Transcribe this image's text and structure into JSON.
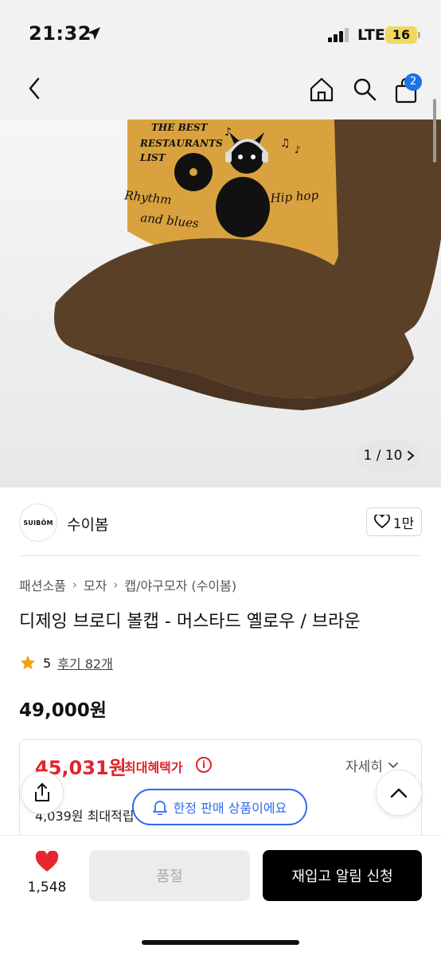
{
  "status_bar": {
    "time": "21:32",
    "network": "LTE",
    "battery": "16"
  },
  "nav": {
    "cart_count": "2"
  },
  "gallery": {
    "counter": "1 / 10",
    "cap_text": {
      "line1": "THE BEST",
      "line2": "RESTAURANTS",
      "line3": "LIST",
      "rhythm": "Rhythm",
      "blues": "and blues",
      "hiphop": "Hip hop"
    }
  },
  "brand": {
    "logo_text": "SUIBŌM",
    "name": "수이봄",
    "likes": "1만"
  },
  "breadcrumb": [
    "패션소품",
    "모자",
    "캡/야구모자 (수이봄)"
  ],
  "product": {
    "title": "디제잉 브로디 볼캡 - 머스타드 옐로우 / 브라운",
    "rating": "5",
    "reviews": "후기 82개",
    "price": "49,000원"
  },
  "benefit": {
    "price": "45,031원",
    "label": "최대혜택가",
    "detail": "자세히",
    "sub": "4,039원 최대적립"
  },
  "toast": {
    "text": "한정 판매 상품이에요"
  },
  "bottom_bar": {
    "heart_count": "1,548",
    "soldout_label": "품절",
    "restock_label": "재입고 알림 신청"
  },
  "colors": {
    "sale_red": "#e0242b",
    "toast_blue": "#2e6bf0",
    "heart_red": "#e8262e",
    "mustard": "#d9a23e",
    "brown": "#5b4028"
  }
}
